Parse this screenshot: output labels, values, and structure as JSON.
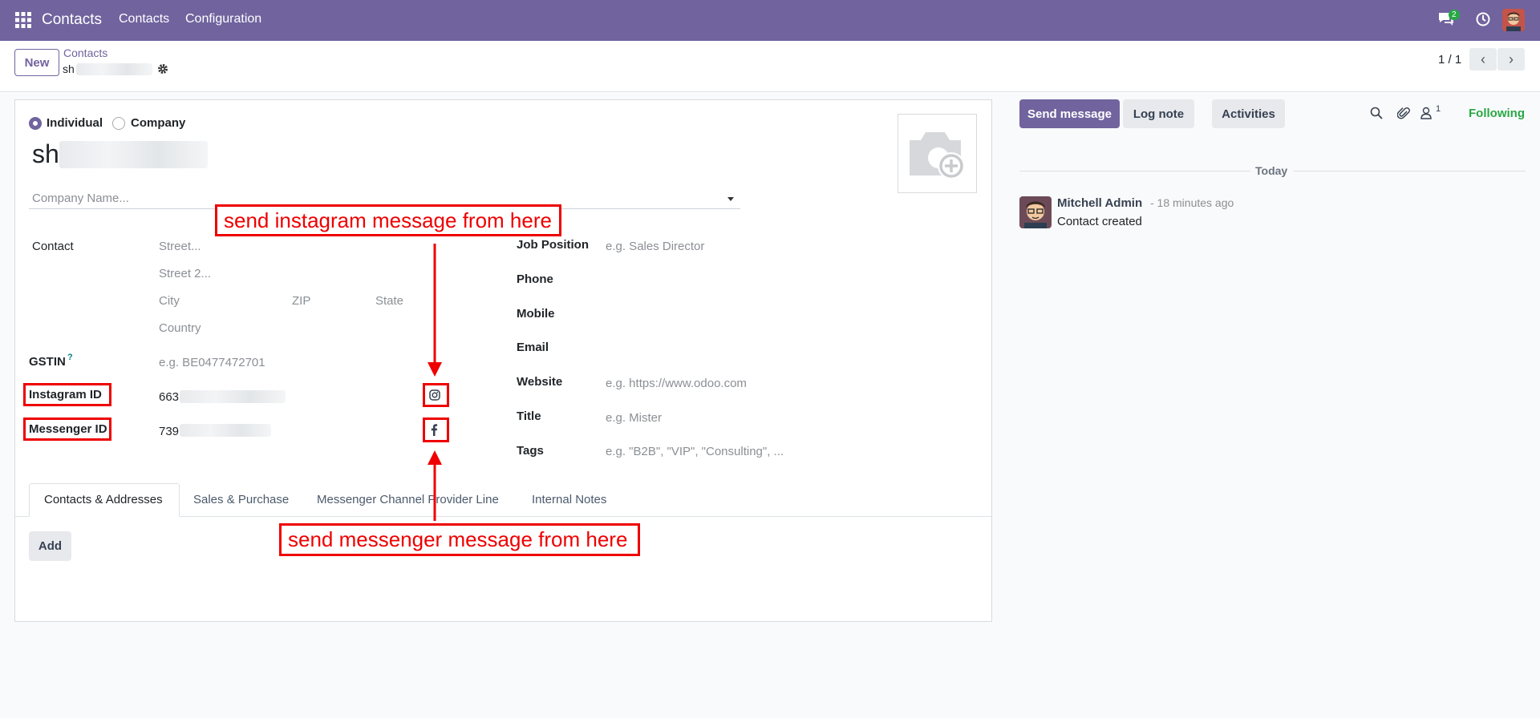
{
  "navbar": {
    "app_name": "Contacts",
    "menu": [
      "Contacts",
      "Configuration"
    ],
    "messages_badge": "2"
  },
  "control_panel": {
    "new_label": "New",
    "breadcrumb_parent": "Contacts",
    "record_name_prefix": "sh",
    "pager": "1 / 1"
  },
  "form": {
    "type_individual": "Individual",
    "type_company": "Company",
    "selected_type": "Individual",
    "name_prefix": "sh",
    "company_placeholder": "Company Name...",
    "contact_label": "Contact",
    "street_placeholder": "Street...",
    "street2_placeholder": "Street 2...",
    "city_placeholder": "City",
    "zip_placeholder": "ZIP",
    "state_placeholder": "State",
    "country_placeholder": "Country",
    "gstin_label": "GSTIN",
    "gstin_help": "?",
    "gstin_placeholder": "e.g. BE0477472701",
    "instagram_label": "Instagram ID",
    "instagram_value_prefix": "663",
    "messenger_label": "Messenger ID",
    "messenger_value_prefix": "739",
    "job_position_label": "Job Position",
    "job_position_placeholder": "e.g. Sales Director",
    "phone_label": "Phone",
    "mobile_label": "Mobile",
    "email_label": "Email",
    "website_label": "Website",
    "website_placeholder": "e.g. https://www.odoo.com",
    "title_label": "Title",
    "title_placeholder": "e.g. Mister",
    "tags_label": "Tags",
    "tags_placeholder": "e.g. \"B2B\", \"VIP\", \"Consulting\", ..."
  },
  "tabs": [
    "Contacts & Addresses",
    "Sales & Purchase",
    "Messenger Channel Provider Line",
    "Internal Notes"
  ],
  "active_tab": "Contacts & Addresses",
  "add_label": "Add",
  "chatter": {
    "send_message": "Send message",
    "log_note": "Log note",
    "activities": "Activities",
    "followers_count": "1",
    "following": "Following",
    "date_separator": "Today",
    "author": "Mitchell Admin",
    "time": "- 18 minutes ago",
    "body": "Contact created"
  },
  "annotations": {
    "instagram": "send instagram message from here",
    "messenger": "send messenger message from here"
  },
  "colors": {
    "brand": "#71639e",
    "annotation_red": "#ee0000",
    "following_green": "#28a745"
  }
}
